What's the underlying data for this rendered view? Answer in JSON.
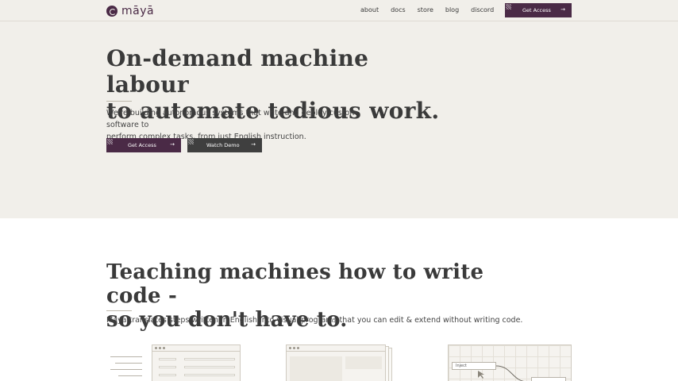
{
  "nav": {
    "logo_text": "māyā",
    "links": [
      "about",
      "docs",
      "store",
      "blog",
      "discord"
    ],
    "cta_label": "Get Access",
    "cta_arrow": "→"
  },
  "hero": {
    "title_line1": "On-demand machine labour",
    "title_line2": "to automate tedious work.",
    "subtitle_line1": "We're building autonomous systems that write and deploy custom software to",
    "subtitle_line2": "perform complex tasks, from just English instruction.",
    "primary_button": "Get Access",
    "secondary_button": "Watch Demo",
    "arrow": "→"
  },
  "section": {
    "title_line1": "Teaching machines how to write code -",
    "title_line2": "so you don't have to.",
    "subtitle": "Maya translates steps written in English into visual programs that you can edit & extend without writing code."
  },
  "illustrations": {
    "node_label": "Inject"
  },
  "colors": {
    "brand": "#4a2a46",
    "hero_bg": "#f1efea",
    "secondary_button": "#3f3f3f"
  }
}
